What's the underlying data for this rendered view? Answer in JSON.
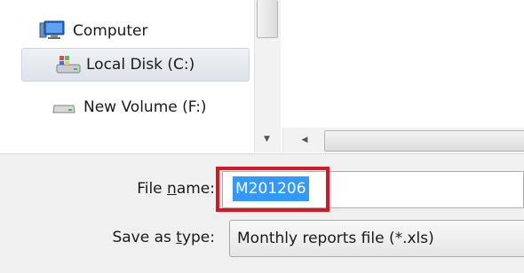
{
  "nav": {
    "items": [
      {
        "label": "Computer",
        "icon": "computer-icon"
      },
      {
        "label": "Local Disk (C:)",
        "icon": "local-disk-icon",
        "selected": true
      },
      {
        "label": "New Volume (F:)",
        "icon": "drive-icon"
      }
    ]
  },
  "form": {
    "filename_label_pre": "File ",
    "filename_label_accel": "n",
    "filename_label_post": "ame:",
    "filename_value": "M201206",
    "saveas_label_pre": "Save as ",
    "saveas_label_accel": "t",
    "saveas_label_post": "ype:",
    "saveas_value": "Monthly reports file (*.xls)"
  },
  "colors": {
    "selection": "#3399ff",
    "highlight_border": "#e0141e",
    "panel_bg": "#f0f0f0"
  }
}
